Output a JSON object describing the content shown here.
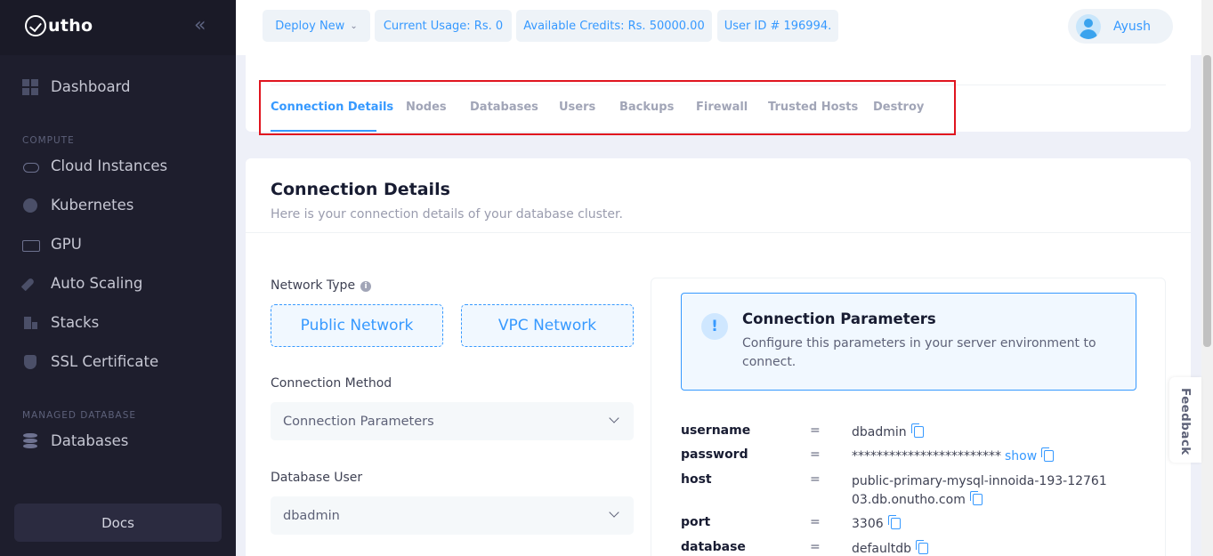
{
  "app": {
    "logo_text": "utho"
  },
  "sidebar": {
    "collapse_glyph": "«",
    "items": [
      {
        "label": "Dashboard",
        "icon": "dashboard-icon"
      },
      {
        "label": "Cloud Instances",
        "icon": "cloud-icon"
      },
      {
        "label": "Kubernetes",
        "icon": "kubernetes-icon"
      },
      {
        "label": "GPU",
        "icon": "gpu-icon"
      },
      {
        "label": "Auto Scaling",
        "icon": "rocket-icon"
      },
      {
        "label": "Stacks",
        "icon": "stacks-icon"
      },
      {
        "label": "SSL Certificate",
        "icon": "shield-icon"
      },
      {
        "label": "Databases",
        "icon": "database-icon"
      }
    ],
    "sections": {
      "compute": "COMPUTE",
      "managed_database": "MANAGED DATABASE"
    },
    "docs_label": "Docs"
  },
  "header": {
    "deploy_new": "Deploy New",
    "current_usage": "Current Usage: Rs. 0",
    "available_credits": "Available Credits: Rs. 50000.00",
    "user_id": "User ID # 196994.",
    "user_name": "Ayush"
  },
  "tabs": [
    {
      "label": "Connection Details",
      "active": true
    },
    {
      "label": "Nodes"
    },
    {
      "label": "Databases"
    },
    {
      "label": "Users"
    },
    {
      "label": "Backups"
    },
    {
      "label": "Firewall"
    },
    {
      "label": "Trusted Hosts"
    },
    {
      "label": "Destroy"
    }
  ],
  "main": {
    "title": "Connection Details",
    "subtitle": "Here is your connection details of your database cluster.",
    "network_type_label": "Network Type",
    "network_options": [
      "Public Network",
      "VPC Network"
    ],
    "connection_method_label": "Connection Method",
    "connection_method_value": "Connection Parameters",
    "database_user_label": "Database User",
    "database_user_value": "dbadmin",
    "notice": {
      "title": "Connection Parameters",
      "text": "Configure this parameters in your server environment to connect."
    },
    "params": [
      {
        "key": "username",
        "eq": "=",
        "value": "dbadmin"
      },
      {
        "key": "password",
        "eq": "=",
        "value": "************************",
        "link": "show"
      },
      {
        "key": "host",
        "eq": "=",
        "value": "public-primary-mysql-innoida-193-1276103.db.onutho.com"
      },
      {
        "key": "port",
        "eq": "=",
        "value": "3306"
      },
      {
        "key": "database",
        "eq": "=",
        "value": "defaultdb"
      }
    ]
  },
  "feedback_label": "Feedback",
  "colors": {
    "accent": "#3699ff",
    "sidebar_bg": "#1e1e2d",
    "highlight": "#e0151f"
  }
}
